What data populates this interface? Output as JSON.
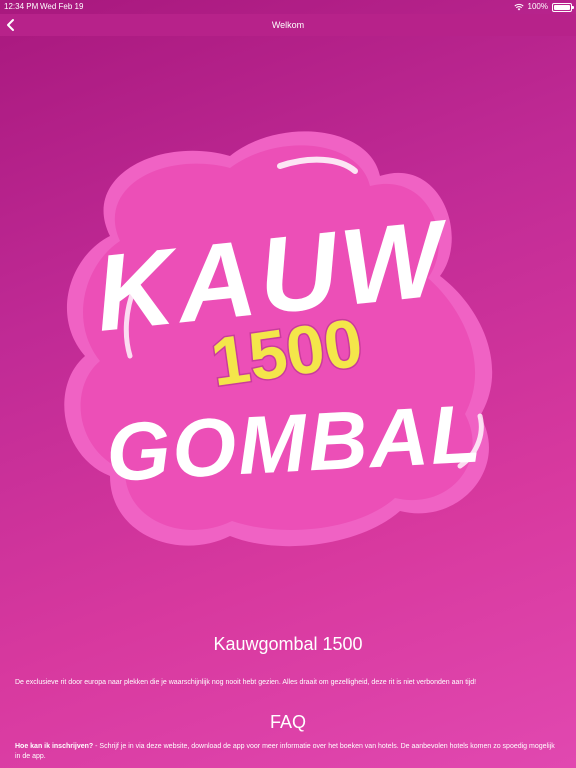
{
  "status_bar": {
    "time": "12:34 PM",
    "date": "Wed Feb 19",
    "battery": "100%",
    "battery_level": 1.0
  },
  "nav": {
    "title": "Welkom",
    "back_icon": "chevron-left-icon"
  },
  "logo": {
    "line1": "KAUW",
    "number": "1500",
    "line2": "GOMBAL",
    "colors": {
      "bubble_outer": "#f062c4",
      "bubble_inner": "#ec4fb7",
      "number_fill": "#f4e64a",
      "letters": "#ffffff"
    }
  },
  "content": {
    "title": "Kauwgombal 1500",
    "description": "De exclusieve rit door europa naar plekken die je waarschijnlijk nog nooit hebt gezien. Alles draait om gezelligheid, deze rit is niet verbonden aan tijd!",
    "faq_heading": "FAQ",
    "faq": [
      {
        "question": "Hoe kan ik inschrijven?",
        "answer": " - Schrijf je in via deze website, download de app voor meer informatie over het boeken van hotels. De aanbevolen hotels komen zo spoedig mogelijk in de app."
      }
    ]
  }
}
